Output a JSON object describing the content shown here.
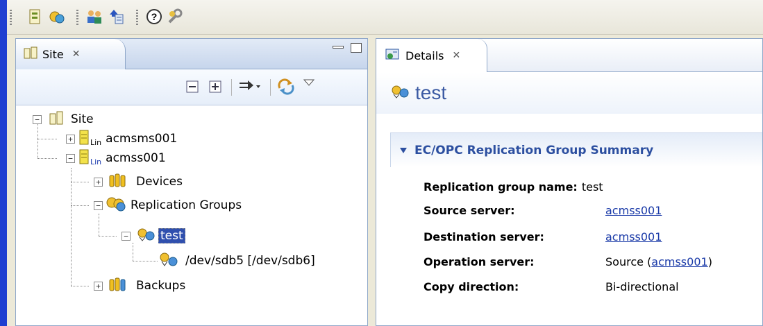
{
  "toolbar": {
    "icons": [
      "new-site-icon",
      "add-server-icon",
      "users-icon",
      "download-icon",
      "help-icon",
      "wrench-icon"
    ]
  },
  "site_view": {
    "tab_label": "Site",
    "tree": {
      "root": "Site",
      "servers": [
        {
          "name": "acmsms001",
          "os_badge": "Lin",
          "expanded": false
        },
        {
          "name": "acmss001",
          "os_badge": "Lin",
          "expanded": true
        }
      ],
      "children": {
        "devices": "Devices",
        "replication_groups": "Replication Groups",
        "group": "test",
        "pair": "/dev/sdb5 [/dev/sdb6]",
        "backups": "Backups"
      }
    }
  },
  "details_view": {
    "tab_label": "Details",
    "form_title": "test",
    "section_title": "EC/OPC Replication Group Summary",
    "properties": [
      {
        "label": "Replication group name:",
        "value": "test",
        "link": false
      },
      {
        "label": "Source server:",
        "value": "acmss001",
        "link": true
      },
      {
        "label": "Destination server:",
        "value": "acmss001",
        "link": true
      },
      {
        "label": "Operation server:",
        "value_prefix": "Source (",
        "value": "acmss001",
        "value_suffix": ")",
        "link": true
      },
      {
        "label": "Copy direction:",
        "value": "Bi-directional",
        "link": false
      }
    ]
  },
  "colors": {
    "accent": "#2c4fa0",
    "selection": "#2f4fae",
    "link": "#1a3aa8"
  }
}
